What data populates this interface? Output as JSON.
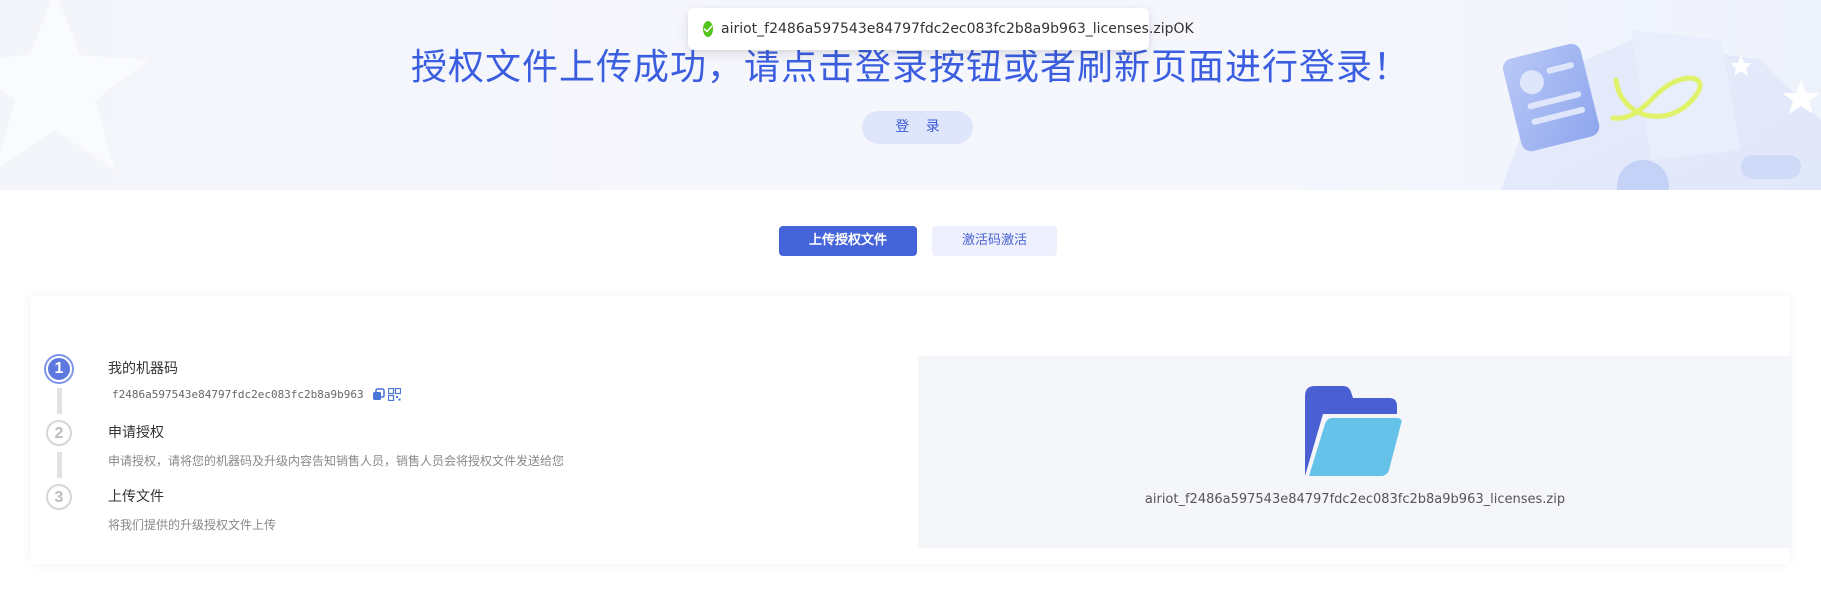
{
  "toast": {
    "message": "airiot_f2486a597543e84797fdc2ec083fc2b8a9b963_licenses.zipOK",
    "status_color": "#52c41a"
  },
  "banner": {
    "title": "授权文件上传成功，请点击登录按钮或者刷新页面进行登录！",
    "login_label": "登 录"
  },
  "tabs": [
    {
      "label": "上传授权文件",
      "active": true
    },
    {
      "label": "激活码激活",
      "active": false
    }
  ],
  "steps": [
    {
      "number": "1",
      "title": "我的机器码",
      "detail": "f2486a597543e84797fdc2ec083fc2b8a9b963",
      "icons": [
        "copy-icon",
        "qrcode-icon"
      ]
    },
    {
      "number": "2",
      "title": "申请授权",
      "detail": "申请授权，请将您的机器码及升级内容告知销售人员，销售人员会将授权文件发送给您"
    },
    {
      "number": "3",
      "title": "上传文件",
      "detail": "将我们提供的升级授权文件上传"
    }
  ],
  "upload": {
    "icon": "folder-icon",
    "file_name": "airiot_f2486a597543e84797fdc2ec083fc2b8a9b963_licenses.zip"
  },
  "colors": {
    "primary": "#4664d9",
    "title": "#3b5ee0",
    "folder_back": "#4a5fd1",
    "folder_front": "#65c2e8"
  }
}
